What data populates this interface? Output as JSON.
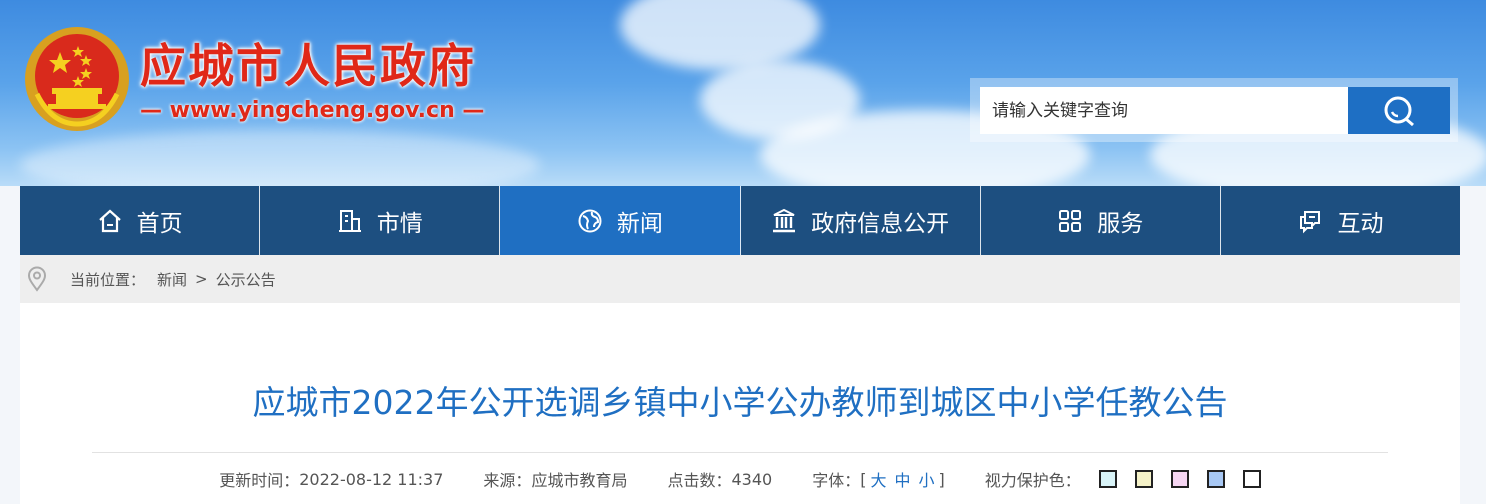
{
  "header": {
    "site_name": "应城市人民政府",
    "site_url": "— www.yingcheng.gov.cn —",
    "search_placeholder": "请输入关键字查询"
  },
  "nav": {
    "items": [
      {
        "label": "首页",
        "icon": "home-icon"
      },
      {
        "label": "市情",
        "icon": "building-icon"
      },
      {
        "label": "新闻",
        "icon": "globe-icon",
        "active": true
      },
      {
        "label": "政府信息公开",
        "icon": "bank-icon"
      },
      {
        "label": "服务",
        "icon": "grid-icon"
      },
      {
        "label": "互动",
        "icon": "chat-icon"
      }
    ]
  },
  "breadcrumb": {
    "label": "当前位置：",
    "items": [
      "新闻",
      "公示公告"
    ],
    "separator": ">"
  },
  "article": {
    "title": "应城市2022年公开选调乡镇中小学公办教师到城区中小学任教公告",
    "updated_label": "更新时间：",
    "updated_value": "2022-08-12 11:37",
    "source_label": "来源：",
    "source_value": "应城市教育局",
    "views_label": "点击数：",
    "views_value": "4340",
    "font_label": "字体：",
    "font_open": "[",
    "font_large": "大",
    "font_medium": "中",
    "font_small": "小",
    "font_close": "]",
    "eye_label": "视力保护色："
  },
  "colors": {
    "nav_bg": "#1d4f80",
    "nav_active": "#1f6fc2",
    "title": "#1f6fc2",
    "brand_red": "#e02818",
    "eye_swatches": [
      "#d9f4f8",
      "#f5f2c8",
      "#f6d6f2",
      "#a8c8f4",
      "#ffffff"
    ]
  }
}
